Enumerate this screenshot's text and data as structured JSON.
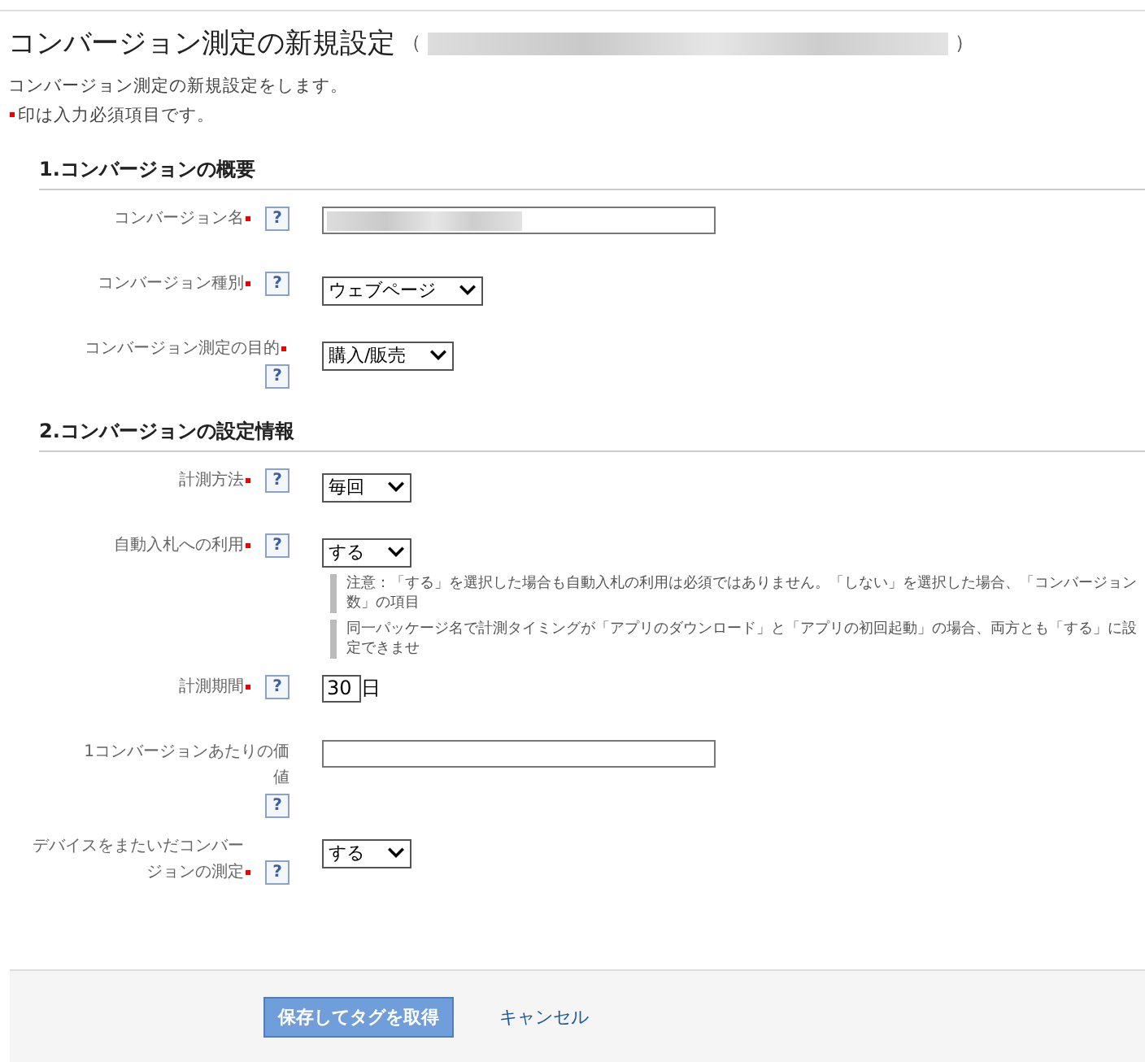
{
  "page": {
    "title": "コンバージョン測定の新規設定",
    "title_suffix_open": "（",
    "title_suffix_close": "）",
    "intro": "コンバージョン測定の新規設定をします。",
    "required_note": "印は入力必須項目です。"
  },
  "sections": [
    {
      "heading": "1.コンバージョンの概要",
      "fields": [
        {
          "kind": "text",
          "label": "コンバージョン名",
          "required": true,
          "help": "?",
          "blurred": true
        },
        {
          "kind": "select",
          "label": "コンバージョン種別",
          "required": true,
          "help": "?",
          "value": "ウェブページ"
        },
        {
          "kind": "select",
          "label": "コンバージョン測定の目的",
          "required": true,
          "help": "?",
          "value": "購入/販売",
          "help_below": true
        }
      ]
    },
    {
      "heading": "2.コンバージョンの設定情報",
      "fields": [
        {
          "kind": "select",
          "label": "計測方法",
          "required": true,
          "help": "?",
          "value": "毎回"
        },
        {
          "kind": "select",
          "label": "自動入札への利用",
          "required": true,
          "help": "?",
          "value": "する",
          "notes": [
            "注意：「する」を選択した場合も自動入札の利用は必須ではありません。「しない」を選択した場合、「コンバージョン数」の項目",
            "同一パッケージ名で計測タイミングが「アプリのダウンロード」と「アプリの初回起動」の場合、両方とも「する」に設定できませ"
          ]
        },
        {
          "kind": "number",
          "label": "計測期間",
          "required": true,
          "help": "?",
          "value": "30",
          "unit": "日"
        },
        {
          "kind": "text",
          "label": "1コンバージョンあたりの価値",
          "required": false,
          "help": "?",
          "help_below": true
        },
        {
          "kind": "select",
          "label": "デバイスをまたいだコンバージョンの測定",
          "required": true,
          "help": "?",
          "value": "する"
        }
      ]
    }
  ],
  "footer": {
    "save": "保存してタグを取得",
    "cancel": "キャンセル"
  }
}
